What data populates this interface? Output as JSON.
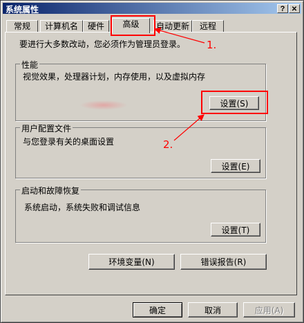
{
  "window": {
    "title": "系统属性",
    "help_glyph": "?",
    "close_glyph": "✕"
  },
  "tabs": [
    {
      "label": "常规"
    },
    {
      "label": "计算机名"
    },
    {
      "label": "硬件"
    },
    {
      "label": "高级"
    },
    {
      "label": "自动更新"
    },
    {
      "label": "远程"
    }
  ],
  "admin_note": "要进行大多数改动，您必须作为管理员登录。",
  "performance": {
    "title": "性能",
    "desc": "视觉效果，处理器计划，内存使用，以及虚拟内存",
    "button": "设置(S)"
  },
  "user_profiles": {
    "title": "用户配置文件",
    "desc": "与您登录有关的桌面设置",
    "button": "设置(E)"
  },
  "startup_recovery": {
    "title": "启动和故障恢复",
    "desc": "系统启动，系统失败和调试信息",
    "button": "设置(T)"
  },
  "env_button": "环境变量(N)",
  "error_report_button": "错误报告(R)",
  "footer": {
    "ok": "确定",
    "cancel": "取消",
    "apply": "应用(A)"
  },
  "annotations": {
    "step1": "1.",
    "step2": "2."
  },
  "colors": {
    "titlebar_start": "#0a246a",
    "titlebar_end": "#a6caf0",
    "annotation": "#ff0000",
    "face": "#d4d0c8"
  }
}
